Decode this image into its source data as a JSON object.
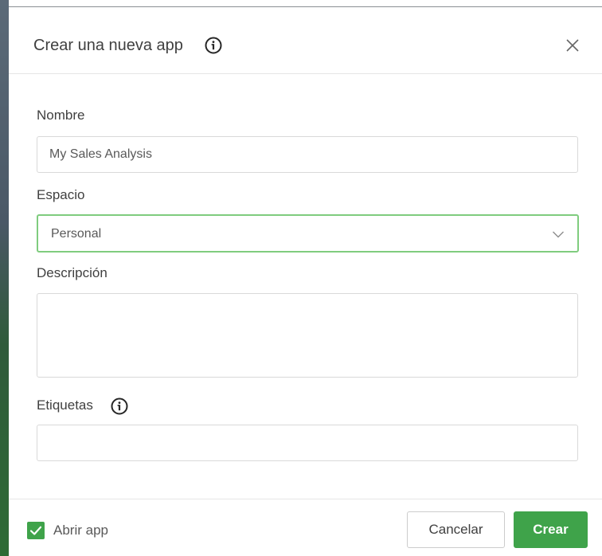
{
  "dialog": {
    "title": "Crear una nueva app",
    "title_icon": "info-icon",
    "close_icon": "close-icon"
  },
  "fields": {
    "name": {
      "label": "Nombre",
      "value": "My Sales Analysis"
    },
    "space": {
      "label": "Espacio",
      "selected": "Personal",
      "icon": "chevron-down-icon"
    },
    "description": {
      "label": "Descripción",
      "value": ""
    },
    "tags": {
      "label": "Etiquetas",
      "icon": "info-icon",
      "value": ""
    }
  },
  "footer": {
    "open_app_label": "Abrir app",
    "open_app_checked": true,
    "cancel_label": "Cancelar",
    "create_label": "Crear"
  },
  "colors": {
    "accent_green": "#3fa34a",
    "focus_border": "#7fcc7e",
    "text_primary": "#404040",
    "border": "#d9d9d9"
  }
}
